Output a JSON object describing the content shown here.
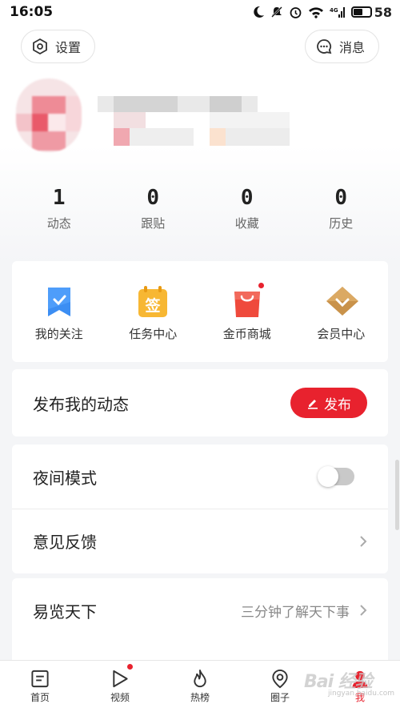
{
  "status_bar": {
    "time": "16:05",
    "battery": "58"
  },
  "header": {
    "settings_label": "设置",
    "messages_label": "消息"
  },
  "stats": [
    {
      "value": "1",
      "label": "动态"
    },
    {
      "value": "0",
      "label": "跟贴"
    },
    {
      "value": "0",
      "label": "收藏"
    },
    {
      "value": "0",
      "label": "历史"
    }
  ],
  "shortcuts": [
    {
      "label": "我的关注",
      "icon": "bookmark-icon"
    },
    {
      "label": "任务中心",
      "icon": "sign-in-icon",
      "glyph": "签"
    },
    {
      "label": "金币商城",
      "icon": "shopping-bag-icon"
    },
    {
      "label": "会员中心",
      "icon": "diamond-icon"
    }
  ],
  "publish": {
    "title": "发布我的动态",
    "button_label": "发布"
  },
  "settings_rows": {
    "night_mode": "夜间模式",
    "feedback": "意见反馈"
  },
  "news_row": {
    "title": "易览天下",
    "subtitle": "三分钟了解天下事"
  },
  "bottom_nav": [
    {
      "label": "首页",
      "icon": "home-icon"
    },
    {
      "label": "视频",
      "icon": "play-icon"
    },
    {
      "label": "热榜",
      "icon": "flame-icon"
    },
    {
      "label": "圈子",
      "icon": "location-circle-icon"
    },
    {
      "label": "我",
      "icon": "profile-icon"
    }
  ],
  "watermark": {
    "text": "Bai 经验",
    "sub": "jingyan.baidu.com"
  },
  "colors": {
    "accent": "#e8222e",
    "background": "#f4f5f7"
  }
}
